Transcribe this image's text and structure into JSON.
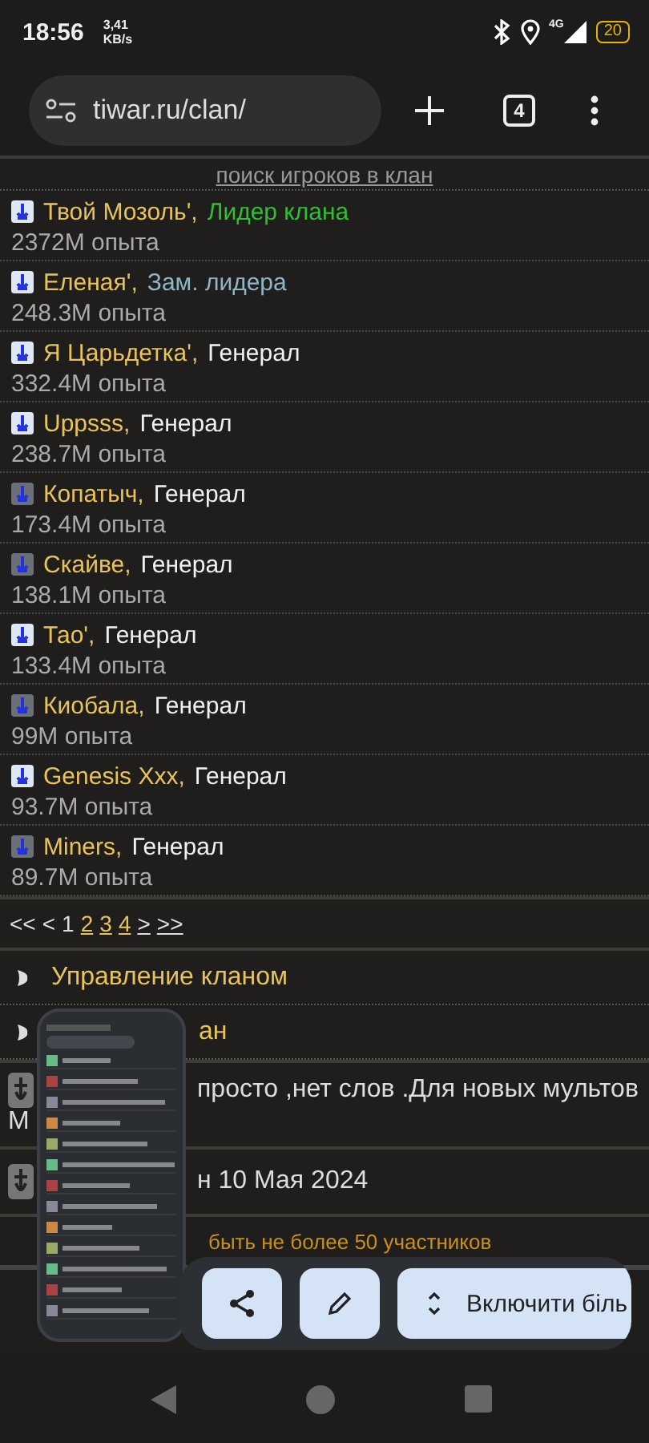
{
  "status_bar": {
    "time": "18:56",
    "speed_value": "3,41",
    "speed_unit": "KB/s",
    "network": "4G",
    "battery": "20"
  },
  "browser": {
    "url": "tiwar.ru/clan/",
    "tab_count": "4"
  },
  "search_link": "поиск игроков в клан",
  "members": [
    {
      "name": "Твой Мозоль',",
      "role": "Лидер клана",
      "color": "#2fbf2f",
      "exp": "2372M опыта",
      "highlighted": true
    },
    {
      "name": "Еленая',",
      "role": "Зам. лидера",
      "color": "#8fb6c6",
      "exp": "248.3M опыта",
      "highlighted": true
    },
    {
      "name": "Я Царьдетка',",
      "role": "Генерал",
      "color": "#f0f0f0",
      "exp": "332.4M опыта",
      "highlighted": true
    },
    {
      "name": "Uppsss,",
      "role": "Генерал",
      "color": "#f0f0f0",
      "exp": "238.7M опыта",
      "highlighted": true
    },
    {
      "name": "Копатыч,",
      "role": "Генерал",
      "color": "#f0f0f0",
      "exp": "173.4M опыта",
      "highlighted": false
    },
    {
      "name": "Скайве,",
      "role": "Генерал",
      "color": "#f0f0f0",
      "exp": "138.1M опыта",
      "highlighted": false
    },
    {
      "name": "Тао',",
      "role": "Генерал",
      "color": "#f0f0f0",
      "exp": "133.4M опыта",
      "highlighted": true
    },
    {
      "name": "Киобала,",
      "role": "Генерал",
      "color": "#f0f0f0",
      "exp": "99M опыта",
      "highlighted": false
    },
    {
      "name": "Genesis Xxx,",
      "role": "Генерал",
      "color": "#f0f0f0",
      "exp": "93.7M опыта",
      "highlighted": true
    },
    {
      "name": "Miners,",
      "role": "Генерал",
      "color": "#f0f0f0",
      "exp": "89.7M опыта",
      "highlighted": false
    }
  ],
  "pagination": [
    {
      "label": "<<",
      "kind": "arrow",
      "link": false
    },
    {
      "label": "<",
      "kind": "arrow",
      "link": false
    },
    {
      "label": "1",
      "kind": "page",
      "link": false
    },
    {
      "label": "2",
      "kind": "page",
      "link": true
    },
    {
      "label": "3",
      "kind": "page",
      "link": true
    },
    {
      "label": "4",
      "kind": "page",
      "link": true
    },
    {
      "label": ">",
      "kind": "arrow",
      "link": true
    },
    {
      "label": ">>",
      "kind": "arrow",
      "link": true
    }
  ],
  "menu": [
    {
      "label": "Управление кланом"
    },
    {
      "label": "ан"
    }
  ],
  "post": {
    "line_1": "просто ,нет слов .Для новых мультов",
    "line_2": "М"
  },
  "date_text": "н 10 Мая 2024",
  "notice": "быть не более 50 участников",
  "toolbar": {
    "expand_button": "Включити біль"
  }
}
